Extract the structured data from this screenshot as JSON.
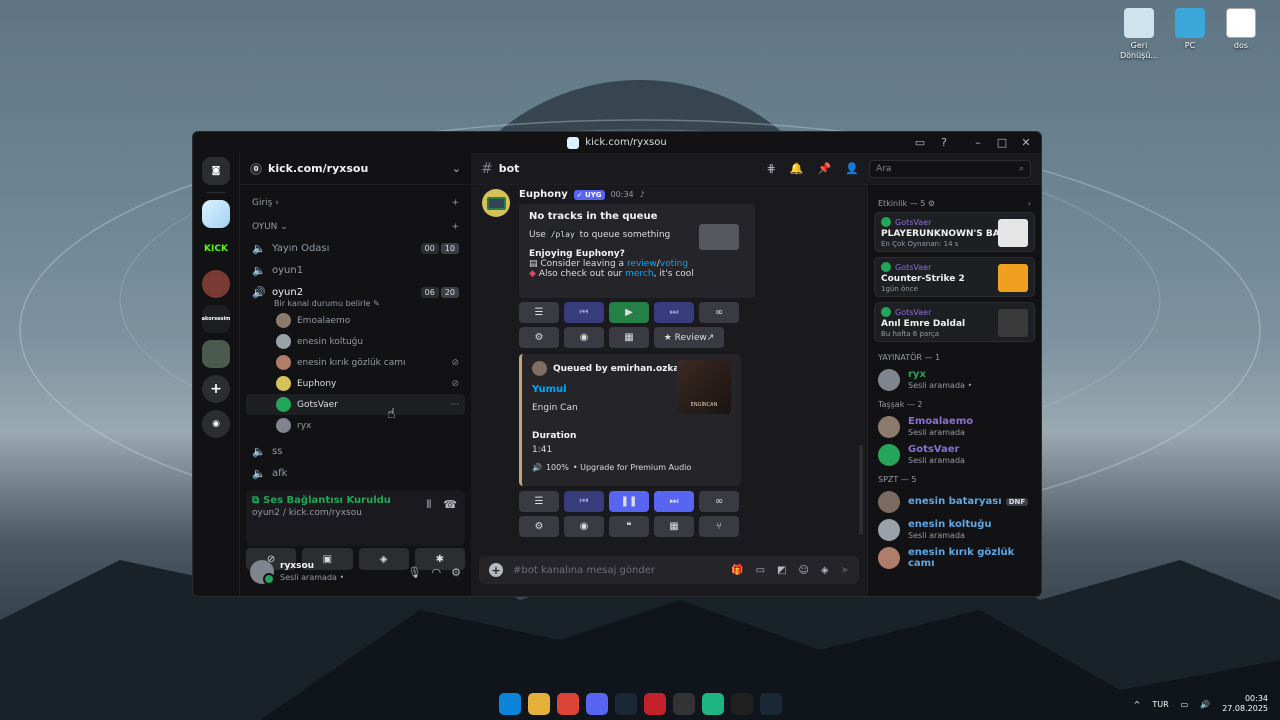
{
  "desktop": {
    "icons": [
      {
        "label": "Geri Dönüşü...",
        "color": "#cfe3ef"
      },
      {
        "label": "PC",
        "color": "#3aa7d8"
      },
      {
        "label": "dos",
        "color": "#ffffff"
      }
    ]
  },
  "taskbar": {
    "lang": "TUR",
    "time": "00:34",
    "date": "27.08.2025",
    "apps": [
      {
        "icon": "windows-icon",
        "color": "#0a84d8"
      },
      {
        "icon": "folder-icon",
        "color": "#e6b13a"
      },
      {
        "icon": "chrome-icon",
        "color": "#db4437"
      },
      {
        "icon": "discord-icon",
        "color": "#5865f2"
      },
      {
        "icon": "steam-icon",
        "color": "#1b2838"
      },
      {
        "icon": "app-red-icon",
        "color": "#c4222a"
      },
      {
        "icon": "app-ring-icon",
        "color": "#333333"
      },
      {
        "icon": "app-green-icon",
        "color": "#1fb583"
      },
      {
        "icon": "app-dark-icon",
        "color": "#202020"
      },
      {
        "icon": "steam-icon",
        "color": "#1b2838"
      }
    ]
  },
  "window": {
    "title": "kick.com/ryxsou"
  },
  "guild": {
    "name": "kick.com/ryxsou",
    "giris": "Giriş",
    "category": "OYUN",
    "channels": [
      {
        "name": "Yayın Odası",
        "b1": "00",
        "b2": "10"
      },
      {
        "name": "oyun1"
      },
      {
        "name": "oyun2",
        "b1": "06",
        "b2": "20",
        "sub": "Bir kanal durumu belirle"
      }
    ],
    "voice_members": [
      {
        "name": "Emoalaemo",
        "color": "#8c7a6c"
      },
      {
        "name": "enesin koltuğu",
        "color": "#9aa1a8"
      },
      {
        "name": "enesin kırık gözlük camı",
        "color": "#b07d6a"
      },
      {
        "name": "Euphony",
        "color": "#d5c35a"
      },
      {
        "name": "GotsVaer",
        "color": "#23a55a"
      },
      {
        "name": "ryx",
        "color": "#80848e"
      }
    ],
    "after": [
      {
        "name": "ss"
      },
      {
        "name": "afk"
      }
    ]
  },
  "voice": {
    "status": "Ses Bağlantısı Kuruldu",
    "location": "oyun2 / kick.com/ryxsou"
  },
  "user": {
    "name": "ryxsou",
    "status": "Sesli aramada •"
  },
  "chat": {
    "channel": "bot",
    "search_placeholder": "Ara",
    "composer_placeholder": "#bot kanalına mesaj gönder",
    "message": {
      "author": "Euphony",
      "app_tag": "✓ UYG",
      "time": "00:34"
    },
    "embed1": {
      "title": "No tracks in the queue",
      "use_a": "Use",
      "use_code": "/play",
      "use_b": "to queue something",
      "enjoy": "Enjoying Euphony?",
      "line1_a": "Consider leaving a",
      "line1_review": "review",
      "line1_sep": "/",
      "line1_voting": "voting",
      "line2_a": "Also check out our",
      "line2_merch": "merch",
      "line2_b": ", it's cool"
    },
    "review_button": "★ Review",
    "embed2": {
      "queued_by": "Queued by emirhan.ozkannn",
      "song": "Yumul",
      "artist": "Engin Can",
      "duration_label": "Duration",
      "duration": "1:41",
      "volume": "100%",
      "premium": "• Upgrade for Premium Audio",
      "cover_text": "ENGİNCAN"
    }
  },
  "members": {
    "activity_header": "Etkinlik — 5",
    "activities": [
      {
        "user": "GotsVaer",
        "game": "PLAYERUNKNOWN'S BAT...",
        "sub": "En Çok Oynanan: 14 s",
        "art": "#e6e6e6"
      },
      {
        "user": "GotsVaer",
        "game": "Counter-Strike 2",
        "sub": "1gün önce",
        "art": "#f0a020"
      },
      {
        "user": "GotsVaer",
        "game": "Anıl Emre Daldal",
        "sub": "Bu hafta 6 parça",
        "art": "#3a3a3a"
      }
    ],
    "groups": [
      {
        "title": "YAYINATÖR — 1",
        "items": [
          {
            "name": "ryx",
            "status": "Sesli aramada •",
            "color": "#23a55a",
            "av": "#80848e"
          }
        ]
      },
      {
        "title": "Taşşak — 2",
        "items": [
          {
            "name": "Emoalaemo",
            "status": "Sesli aramada",
            "color": "#8a6fd6",
            "av": "#8c7a6c"
          },
          {
            "name": "GotsVaer",
            "status": "Sesli aramada",
            "color": "#8a6fd6",
            "av": "#23a55a"
          }
        ]
      },
      {
        "title": "SPZT — 5",
        "items": [
          {
            "name": "enesin bataryası",
            "status": "",
            "dnd": "DNF",
            "color": "#5ea8e6",
            "av": "#7a6a60"
          },
          {
            "name": "enesin koltuğu",
            "status": "Sesli aramada",
            "color": "#5ea8e6",
            "av": "#9aa1a8"
          },
          {
            "name": "enesin kırık gözlük camı",
            "status": "",
            "color": "#5ea8e6",
            "av": "#b07d6a"
          }
        ]
      }
    ]
  }
}
